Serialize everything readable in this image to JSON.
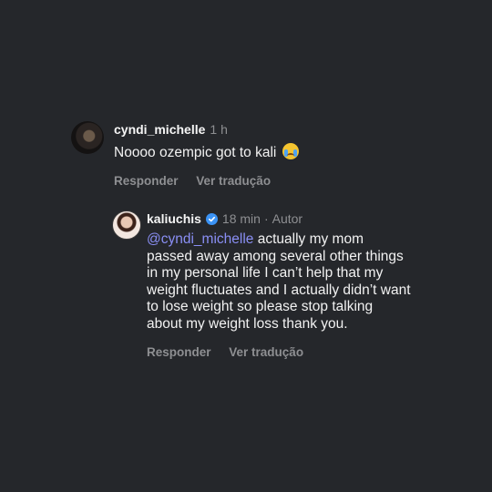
{
  "comments": [
    {
      "username": "cyndi_michelle",
      "time": "1 h",
      "text": "Noooo ozempic got to kali",
      "emoji": "crying-face-icon",
      "reply_label": "Responder",
      "translate_label": "Ver tradução"
    },
    {
      "username": "kaliuchis",
      "verified": true,
      "time": "18 min",
      "separator": "·",
      "author_label": "Autor",
      "mention": "@cyndi_michelle",
      "text": " actually my mom passed away among several other things in my personal life I can’t help that my weight fluctuates and I actually didn’t want to lose weight so please stop talking about my weight loss thank you.",
      "reply_label": "Responder",
      "translate_label": "Ver tradução"
    }
  ],
  "colors": {
    "background": "#25272b",
    "mention": "#8a8ff5",
    "verified": "#3b93f5",
    "muted": "#8e8f92"
  }
}
